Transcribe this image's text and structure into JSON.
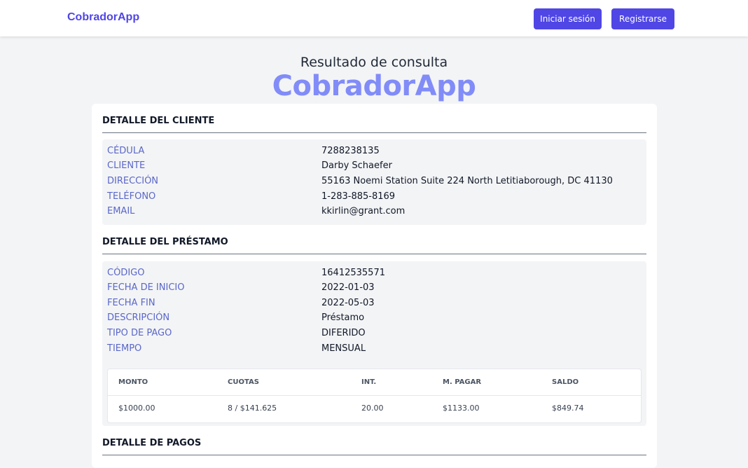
{
  "navbar": {
    "brand": "CobradorApp",
    "login_label": "Iniciar sesión",
    "register_label": "Registrarse"
  },
  "header": {
    "subtitle": "Resultado de consulta",
    "title": "CobradorApp"
  },
  "client": {
    "section_title": "DETALLE DEL CLIENTE",
    "fields": [
      {
        "label": "CÉDULA",
        "value": "7288238135"
      },
      {
        "label": "CLIENTE",
        "value": "Darby Schaefer"
      },
      {
        "label": "DIRECCIÓN",
        "value": "55163 Noemi Station Suite 224 North Letitiaborough, DC 41130"
      },
      {
        "label": "TELÉFONO",
        "value": "1-283-885-8169"
      },
      {
        "label": "EMAIL",
        "value": "kkirlin@grant.com"
      }
    ]
  },
  "loan": {
    "section_title": "DETALLE DEL PRÉSTAMO",
    "fields": [
      {
        "label": "CÓDIGO",
        "value": "16412535571"
      },
      {
        "label": "FECHA DE INICIO",
        "value": "2022-01-03"
      },
      {
        "label": "FECHA FIN",
        "value": "2022-05-03"
      },
      {
        "label": "DESCRIPCIÓN",
        "value": "Préstamo"
      },
      {
        "label": "TIPO DE PAGO",
        "value": "DIFERIDO"
      },
      {
        "label": "TIEMPO",
        "value": "MENSUAL"
      }
    ],
    "table": {
      "headers": [
        "MONTO",
        "CUOTAS",
        "INT.",
        "M. PAGAR",
        "SALDO"
      ],
      "row": [
        "$1000.00",
        "8 / $141.625",
        "20.00",
        "$1133.00",
        "$849.74"
      ]
    }
  },
  "payments": {
    "section_title": "DETALLE DE PAGOS"
  },
  "colors": {
    "primary": "#4f46e5",
    "hero": "#818cf8",
    "label": "#5a67c8",
    "background": "#f3f4f6"
  }
}
